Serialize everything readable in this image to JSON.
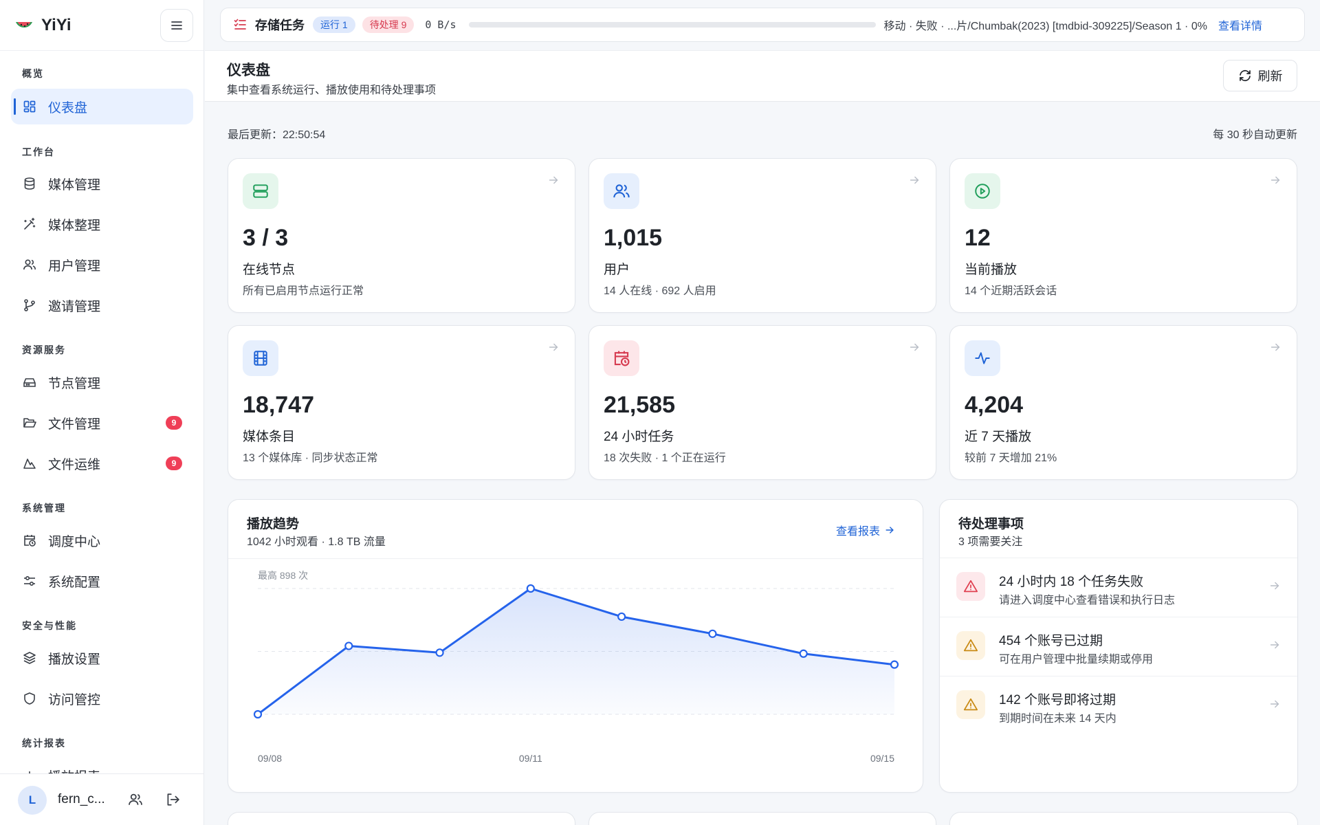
{
  "app": {
    "name": "YiYi"
  },
  "sidebar": {
    "sections": [
      {
        "title": "概览",
        "items": [
          {
            "label": "仪表盘",
            "icon": "dashboard-icon",
            "active": true
          }
        ]
      },
      {
        "title": "工作台",
        "items": [
          {
            "label": "媒体管理",
            "icon": "database-icon"
          },
          {
            "label": "媒体整理",
            "icon": "magic-wand-icon"
          },
          {
            "label": "用户管理",
            "icon": "users-icon"
          },
          {
            "label": "邀请管理",
            "icon": "git-branch-icon"
          }
        ]
      },
      {
        "title": "资源服务",
        "items": [
          {
            "label": "节点管理",
            "icon": "hard-drive-icon"
          },
          {
            "label": "文件管理",
            "icon": "folder-open-icon",
            "badge": "9"
          },
          {
            "label": "文件运维",
            "icon": "mountain-icon",
            "badge": "9"
          }
        ]
      },
      {
        "title": "系统管理",
        "items": [
          {
            "label": "调度中心",
            "icon": "calendar-clock-icon"
          },
          {
            "label": "系统配置",
            "icon": "sliders-icon"
          }
        ]
      },
      {
        "title": "安全与性能",
        "items": [
          {
            "label": "播放设置",
            "icon": "layers-icon"
          },
          {
            "label": "访问管控",
            "icon": "shield-icon"
          }
        ]
      },
      {
        "title": "统计报表",
        "items": [
          {
            "label": "播放报表",
            "icon": "bar-chart-icon"
          }
        ]
      }
    ],
    "user": {
      "initial": "L",
      "name": "fern_c..."
    }
  },
  "topbar": {
    "title": "存储任务",
    "running_label": "运行 1",
    "pending_label": "待处理 9",
    "speed": "0 B/s",
    "progress": 0,
    "status": "移动 · 失败 · ...片/Chumbak(2023) [tmdbid-309225]/Season 1 · 0%",
    "detail_link": "查看详情"
  },
  "header": {
    "title": "仪表盘",
    "subtitle": "集中查看系统运行、播放使用和待处理事项",
    "refresh_label": "刷新"
  },
  "meta": {
    "last_updated": "最后更新：22:50:54",
    "auto_refresh": "每 30 秒自动更新"
  },
  "stats": [
    {
      "value": "3 / 3",
      "label": "在线节点",
      "sub": "所有已启用节点运行正常",
      "icon": "server-icon",
      "tone": "green"
    },
    {
      "value": "1,015",
      "label": "用户",
      "sub": "14 人在线 · 692 人启用",
      "icon": "users-icon",
      "tone": "blue"
    },
    {
      "value": "12",
      "label": "当前播放",
      "sub": "14 个近期活跃会话",
      "icon": "play-circle-icon",
      "tone": "green"
    },
    {
      "value": "18,747",
      "label": "媒体条目",
      "sub": "13 个媒体库 · 同步状态正常",
      "icon": "film-icon",
      "tone": "blue"
    },
    {
      "value": "21,585",
      "label": "24 小时任务",
      "sub": "18 次失败 · 1 个正在运行",
      "icon": "calendar-clock-icon",
      "tone": "red"
    },
    {
      "value": "4,204",
      "label": "近 7 天播放",
      "sub": "较前 7 天增加 21%",
      "icon": "activity-icon",
      "tone": "blue"
    }
  ],
  "trend": {
    "title": "播放趋势",
    "subtitle": "1042 小时观看 · 1.8 TB 流量",
    "report_link": "查看报表"
  },
  "chart_data": {
    "type": "area",
    "title": "播放趋势",
    "x": [
      "09/08",
      "09/09",
      "09/10",
      "09/11",
      "09/12",
      "09/13",
      "09/14",
      "09/15"
    ],
    "x_tick_labels": [
      "09/08",
      "09/11",
      "09/15"
    ],
    "series": [
      {
        "values": [
          0,
          488,
          440,
          898,
          697,
          575,
          433,
          355
        ]
      }
    ],
    "ylim": [
      0,
      898
    ],
    "max_label": "最高 898 次",
    "grid": true,
    "color": "#2563eb"
  },
  "todos": {
    "title": "待处理事项",
    "subtitle": "3 项需要关注",
    "items": [
      {
        "title": "24 小时内 18 个任务失败",
        "sub": "请进入调度中心查看错误和执行日志",
        "tone": "red"
      },
      {
        "title": "454 个账号已过期",
        "sub": "可在用户管理中批量续期或停用",
        "tone": "amber"
      },
      {
        "title": "142 个账号即将过期",
        "sub": "到期时间在未来 14 天内",
        "tone": "amber"
      }
    ]
  }
}
